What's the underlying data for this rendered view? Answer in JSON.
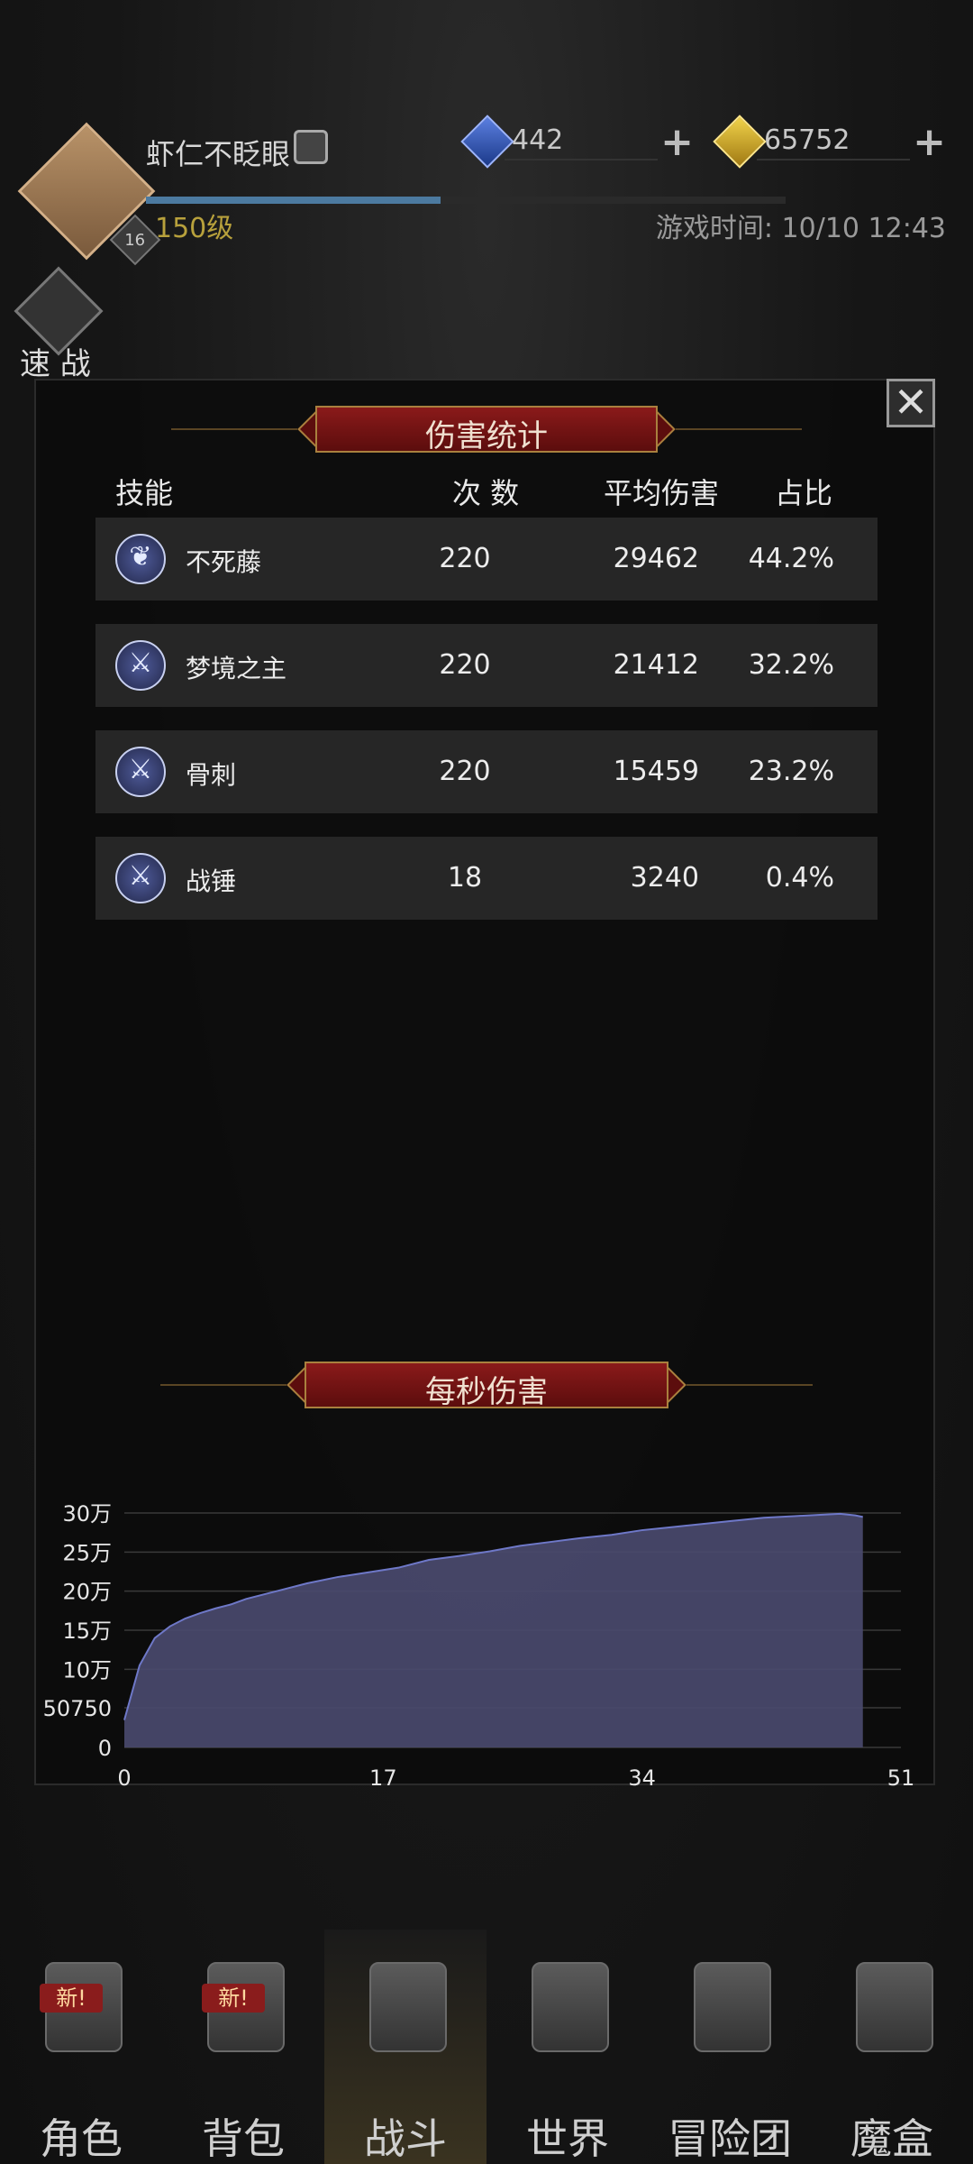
{
  "header": {
    "player_name": "虾仁不眨眼",
    "player_level": "150级",
    "badge_level": "16",
    "game_time": "游戏时间: 10/10 12:43",
    "exp_progress": 0.46,
    "gems": "442",
    "gold": "65752",
    "quick_battle_label": "速 战"
  },
  "damage_stats": {
    "title": "伤害统计",
    "headers": {
      "skill": "技能",
      "count": "次 数",
      "avg": "平均伤害",
      "ratio": "占比"
    },
    "rows": [
      {
        "name": "不死藤",
        "count": "220",
        "avg": "29462",
        "ratio": "44.2%"
      },
      {
        "name": "梦境之主",
        "count": "220",
        "avg": "21412",
        "ratio": "32.2%"
      },
      {
        "name": "骨刺",
        "count": "220",
        "avg": "15459",
        "ratio": "23.2%"
      },
      {
        "name": "战锤",
        "count": "18",
        "avg": "3240",
        "ratio": "0.4%"
      }
    ]
  },
  "dps": {
    "title": "每秒伤害"
  },
  "chart_data": {
    "type": "area",
    "title": "每秒伤害",
    "xlim": [
      0,
      51
    ],
    "ylim": [
      0,
      300000
    ],
    "x_ticks": [
      "0",
      "17",
      "34",
      "51"
    ],
    "y_ticks": [
      "0",
      "50750",
      "10万",
      "15万",
      "20万",
      "25万",
      "30万"
    ],
    "y_tick_values": [
      0,
      50750,
      100000,
      150000,
      200000,
      250000,
      300000
    ],
    "x_tick_values": [
      0,
      17,
      34,
      51
    ],
    "x": [
      0,
      1,
      2,
      3,
      4,
      5,
      6,
      7,
      8,
      10,
      12,
      14,
      16,
      18,
      20,
      22,
      24,
      26,
      28,
      30,
      32,
      34,
      36,
      38,
      40,
      42,
      44,
      46,
      47,
      48,
      48.5
    ],
    "y": [
      35000,
      105000,
      140000,
      155000,
      165000,
      172000,
      178000,
      183000,
      190000,
      200000,
      210000,
      218000,
      224000,
      230000,
      240000,
      245000,
      251000,
      258000,
      263000,
      268000,
      272000,
      278000,
      282000,
      286000,
      290000,
      294000,
      296000,
      298000,
      299000,
      297000,
      295000
    ],
    "grid": true,
    "fill_color": "#4a4a6e",
    "line_color": "#6e78c8"
  },
  "nav": {
    "items": [
      {
        "label": "角色",
        "icon": "helmet-icon",
        "badge": "新!"
      },
      {
        "label": "背包",
        "icon": "backpack-icon",
        "badge": "新!"
      },
      {
        "label": "战斗",
        "icon": "sword-shield-icon",
        "badge": ""
      },
      {
        "label": "世界",
        "icon": "map-icon",
        "badge": ""
      },
      {
        "label": "冒险团",
        "icon": "castle-icon",
        "badge": ""
      },
      {
        "label": "魔盒",
        "icon": "cube-icon",
        "badge": ""
      }
    ]
  },
  "colors": {
    "panel_bg": "#0d0d0d",
    "banner_red": "#8a1a1a",
    "level_gold": "#b8a13c",
    "accent_blue": "#4c7aa0"
  }
}
